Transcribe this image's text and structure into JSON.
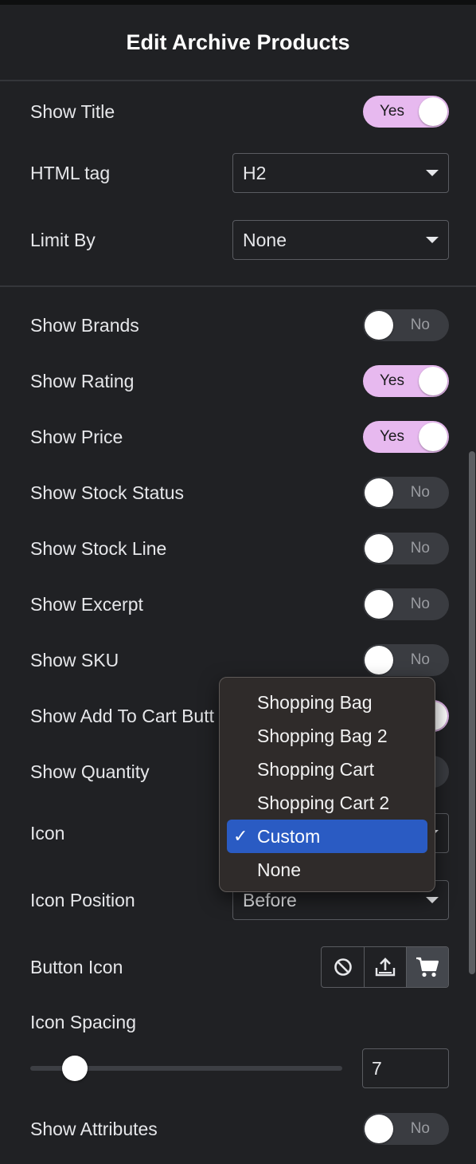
{
  "header": {
    "title": "Edit Archive Products"
  },
  "rows": {
    "show_title": {
      "label": "Show Title",
      "state": "Yes"
    },
    "html_tag": {
      "label": "HTML tag",
      "value": "H2"
    },
    "limit_by": {
      "label": "Limit By",
      "value": "None"
    },
    "show_brands": {
      "label": "Show Brands",
      "state": "No"
    },
    "show_rating": {
      "label": "Show Rating",
      "state": "Yes"
    },
    "show_price": {
      "label": "Show Price",
      "state": "Yes"
    },
    "show_stock_status": {
      "label": "Show Stock Status",
      "state": "No"
    },
    "show_stock_line": {
      "label": "Show Stock Line",
      "state": "No"
    },
    "show_excerpt": {
      "label": "Show Excerpt",
      "state": "No"
    },
    "show_sku": {
      "label": "Show SKU",
      "state": "No"
    },
    "show_add_to_cart": {
      "label": "Show Add To Cart Butt"
    },
    "show_quantity": {
      "label": "Show Quantity"
    },
    "icon": {
      "label": "Icon"
    },
    "icon_position": {
      "label": "Icon Position",
      "value": "Before"
    },
    "button_icon": {
      "label": "Button Icon",
      "icons": [
        "ban-icon",
        "upload-icon",
        "cart-icon"
      ],
      "active": "cart-icon"
    },
    "icon_spacing": {
      "label": "Icon Spacing",
      "value": "7",
      "slider_level": 0.14
    },
    "show_attributes": {
      "label": "Show Attributes",
      "state": "No"
    }
  },
  "icon_dropdown": {
    "options": [
      "Shopping Bag",
      "Shopping Bag 2",
      "Shopping Cart",
      "Shopping Cart 2",
      "Custom",
      "None"
    ],
    "selected": "Custom",
    "check_glyph": "✓"
  },
  "colors": {
    "background": "#202124",
    "toggle_on": "#e7b9ef",
    "toggle_off": "#3a3c41",
    "menu_selected": "#2a5bc3"
  }
}
